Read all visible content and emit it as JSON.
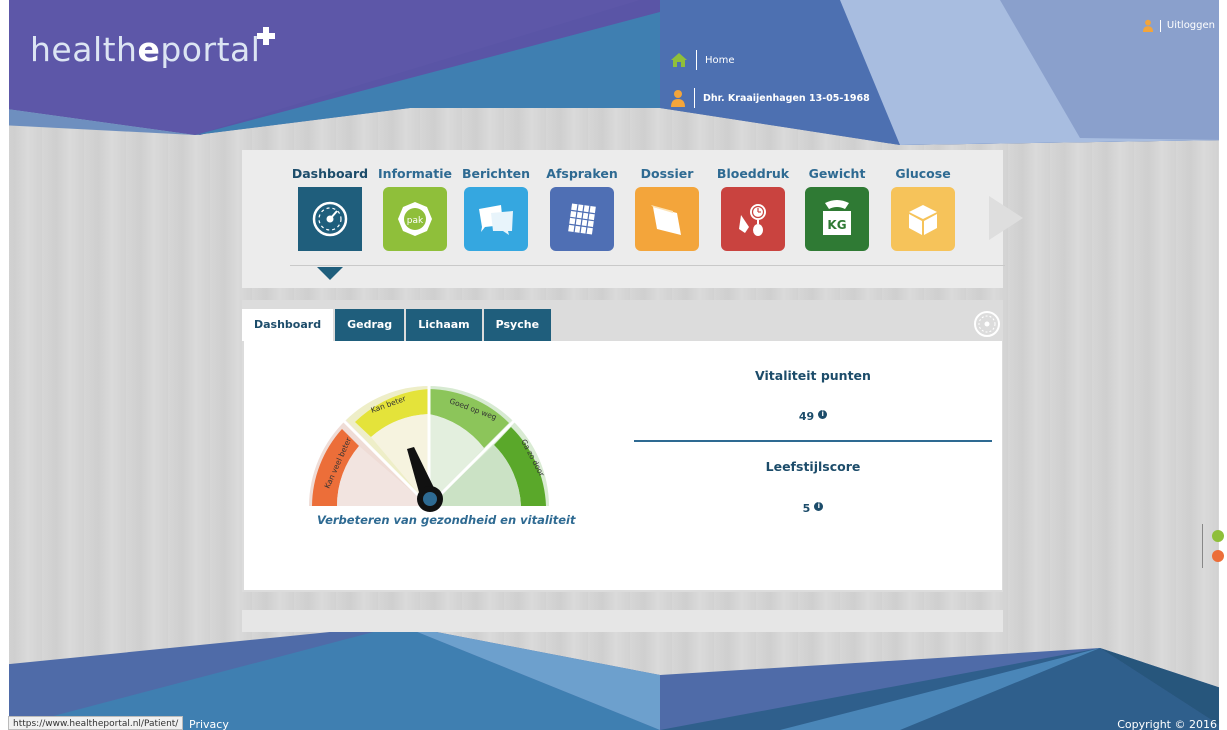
{
  "brand": {
    "logo_prefix": "health",
    "logo_bold": "e",
    "logo_suffix": "portal",
    "colors": {
      "primary": "#1f5e7c",
      "text_blue": "#2e6a92",
      "header_dark": "#4f6ba8"
    }
  },
  "header": {
    "home_label": "Home",
    "patient_label": "Dhr. Kraaijenhagen 13-05-1968",
    "logout_label": "Uitloggen"
  },
  "main_nav": {
    "items": [
      {
        "label": "Dashboard",
        "icon": "speedometer-icon",
        "color": "#1f5e7c",
        "active": true
      },
      {
        "label": "Informatie",
        "icon": "pak-icon",
        "icon_text": "pak",
        "color": "#8fbf3a"
      },
      {
        "label": "Berichten",
        "icon": "messages-icon",
        "color": "#35a7e0"
      },
      {
        "label": "Afspraken",
        "icon": "calendar-icon",
        "color": "#4f6fb4"
      },
      {
        "label": "Dossier",
        "icon": "folder-icon",
        "color": "#f3a53b"
      },
      {
        "label": "Bloeddruk",
        "icon": "blood-pressure-icon",
        "color": "#c9433f"
      },
      {
        "label": "Gewicht",
        "icon": "scale-icon",
        "icon_text": "KG",
        "color": "#2f7a34"
      },
      {
        "label": "Glucose",
        "icon": "box-icon",
        "color": "#f6c35a"
      }
    ]
  },
  "tabs": [
    {
      "label": "Dashboard",
      "active": true
    },
    {
      "label": "Gedrag"
    },
    {
      "label": "Lichaam"
    },
    {
      "label": "Psyche"
    }
  ],
  "gauge": {
    "segments": [
      "Kan veel beter",
      "Kan beter",
      "Goed op weg",
      "Ga zo door"
    ],
    "caption": "Verbeteren van gezondheid en vitaliteit"
  },
  "stats": {
    "vitality_title": "Vitaliteit punten",
    "vitality_value": "49",
    "lifestyle_title": "Leefstijlscore",
    "lifestyle_value": "5",
    "info_glyph": "i"
  },
  "footer": {
    "status_url": "https://www.healtheportal.nl/Patient/",
    "privacy": "Privacy",
    "copyright": "Copyright © 2016"
  }
}
